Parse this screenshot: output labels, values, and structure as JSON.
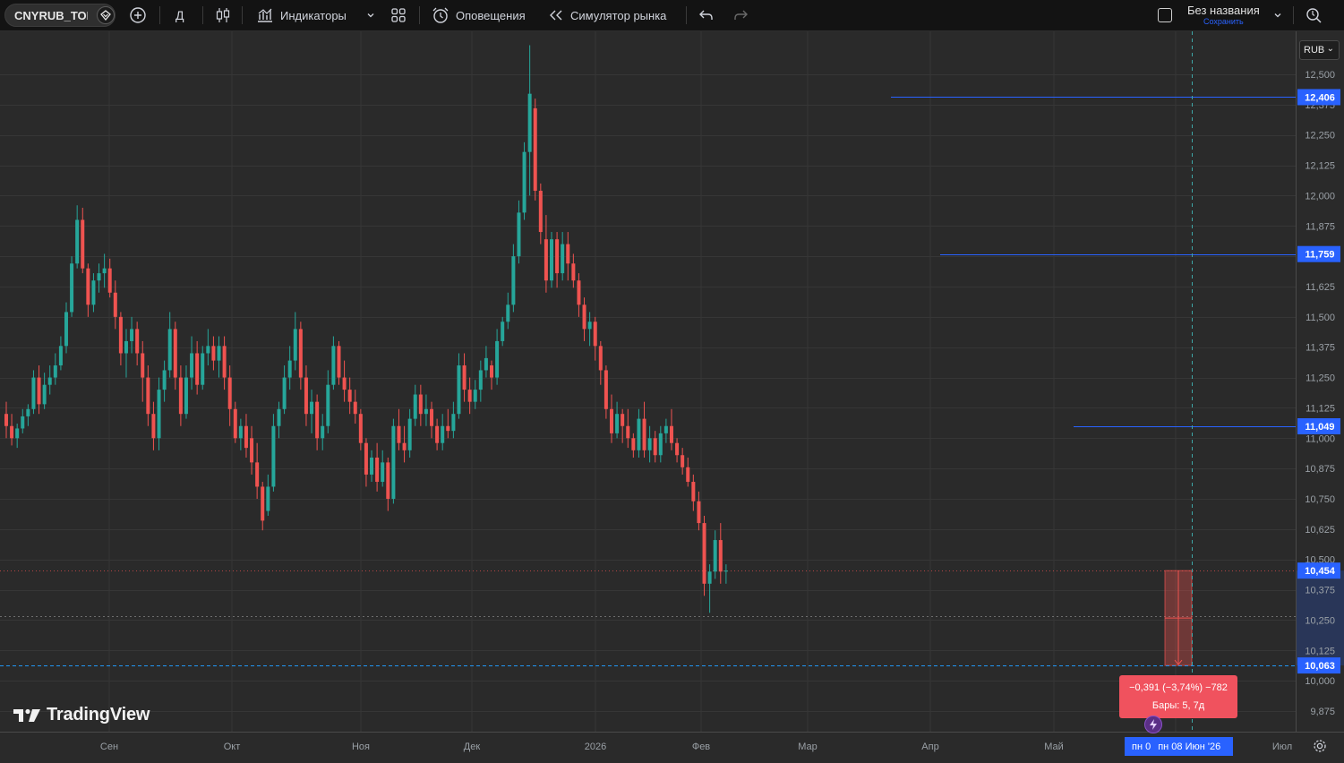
{
  "toolbar": {
    "symbol": "CNYRUB_TOM",
    "add_icon": "plus-circle-icon",
    "interval": "Д",
    "chart_type_icon": "candles-icon",
    "indicators_label": "Индикаторы",
    "templates_icon": "templates-grid-icon",
    "alerts_label": "Оповещения",
    "replay_label": "Симулятор рынка",
    "undo_icon": "undo-icon",
    "redo_icon": "redo-icon",
    "layout_name": "Без названия",
    "layout_save": "Сохранить",
    "quick_search_icon": "search-icon"
  },
  "currency": "RUB",
  "watermark": "TradingView",
  "measure": {
    "line1": "−0,391 (−3,74%) −782",
    "line2": "Бары: 5, 7д"
  },
  "cursor_date": {
    "a": "пн 0",
    "b": "пн 08 Июн '26"
  },
  "colors": {
    "up": "#26a69a",
    "down": "#ef5350",
    "price_line": "#2962ff",
    "crosshair": "#2196f3",
    "background": "#2a2a2a"
  },
  "chart_data": {
    "type": "candlestick",
    "symbol": "CNYRUB_TOM",
    "timeframe": "Д",
    "currency": "RUB",
    "ylim": [
      9.8,
      12.65
    ],
    "y_ticks": [
      "12,500",
      "12,375",
      "12,250",
      "12,125",
      "12,000",
      "11,875",
      "11,750",
      "11,625",
      "11,500",
      "11,375",
      "11,250",
      "11,125",
      "11,000",
      "10,875",
      "10,750",
      "10,625",
      "10,500",
      "10,375",
      "10,250",
      "10,125",
      "10,000",
      "9,875"
    ],
    "x_labels": [
      "Сен",
      "Окт",
      "Ноя",
      "Дек",
      "2026",
      "Фев",
      "Мар",
      "Апр",
      "Май",
      "Июл"
    ],
    "price_labels": [
      {
        "value": 12.406,
        "text": "12,406"
      },
      {
        "value": 11.759,
        "text": "11,759"
      },
      {
        "value": 11.049,
        "text": "11,049"
      },
      {
        "value": 10.454,
        "text": "10,454"
      },
      {
        "value": 10.063,
        "text": "10,063"
      }
    ],
    "horizontal_rays": [
      {
        "value": 12.406,
        "start": "2026-03-20"
      },
      {
        "value": 11.759,
        "start": "2026-04-01"
      },
      {
        "value": 11.049,
        "start": "2026-05-04"
      }
    ],
    "last_close": 10.454,
    "measure_target": 10.063,
    "crosshair_price": 10.063,
    "crosshair_date": "2026-06-08",
    "candles_ohlc": [
      [
        11.1,
        11.15,
        11.0,
        11.05
      ],
      [
        11.05,
        11.1,
        10.97,
        11.0
      ],
      [
        11.0,
        11.06,
        10.96,
        11.04
      ],
      [
        11.04,
        11.12,
        11.02,
        11.09
      ],
      [
        11.09,
        11.14,
        11.05,
        11.12
      ],
      [
        11.12,
        11.28,
        11.1,
        11.25
      ],
      [
        11.25,
        11.3,
        11.1,
        11.14
      ],
      [
        11.14,
        11.27,
        11.12,
        11.22
      ],
      [
        11.22,
        11.3,
        11.18,
        11.25
      ],
      [
        11.25,
        11.35,
        11.22,
        11.3
      ],
      [
        11.3,
        11.42,
        11.28,
        11.38
      ],
      [
        11.38,
        11.56,
        11.35,
        11.52
      ],
      [
        11.52,
        11.75,
        11.5,
        11.72
      ],
      [
        11.72,
        11.96,
        11.7,
        11.9
      ],
      [
        11.9,
        11.95,
        11.68,
        11.7
      ],
      [
        11.7,
        11.72,
        11.5,
        11.55
      ],
      [
        11.55,
        11.68,
        11.52,
        11.65
      ],
      [
        11.65,
        11.72,
        11.6,
        11.68
      ],
      [
        11.68,
        11.76,
        11.62,
        11.7
      ],
      [
        11.7,
        11.74,
        11.58,
        11.6
      ],
      [
        11.6,
        11.65,
        11.45,
        11.5
      ],
      [
        11.5,
        11.52,
        11.3,
        11.35
      ],
      [
        11.35,
        11.45,
        11.25,
        11.4
      ],
      [
        11.4,
        11.5,
        11.35,
        11.45
      ],
      [
        11.45,
        11.48,
        11.3,
        11.35
      ],
      [
        11.35,
        11.4,
        11.15,
        11.25
      ],
      [
        11.25,
        11.3,
        11.05,
        11.1
      ],
      [
        11.1,
        11.15,
        10.95,
        11.0
      ],
      [
        11.0,
        11.25,
        10.95,
        11.2
      ],
      [
        11.2,
        11.32,
        11.15,
        11.28
      ],
      [
        11.28,
        11.52,
        11.25,
        11.45
      ],
      [
        11.45,
        11.48,
        11.2,
        11.25
      ],
      [
        11.25,
        11.3,
        11.05,
        11.1
      ],
      [
        11.1,
        11.3,
        11.08,
        11.25
      ],
      [
        11.25,
        11.42,
        11.2,
        11.35
      ],
      [
        11.35,
        11.4,
        11.18,
        11.22
      ],
      [
        11.22,
        11.38,
        11.2,
        11.35
      ],
      [
        11.35,
        11.45,
        11.3,
        11.38
      ],
      [
        11.38,
        11.42,
        11.28,
        11.32
      ],
      [
        11.32,
        11.42,
        11.25,
        11.38
      ],
      [
        11.38,
        11.42,
        11.2,
        11.25
      ],
      [
        11.25,
        11.3,
        11.05,
        11.12
      ],
      [
        11.12,
        11.15,
        10.98,
        11.0
      ],
      [
        11.0,
        11.08,
        10.95,
        11.05
      ],
      [
        11.05,
        11.1,
        10.92,
        10.96
      ],
      [
        11.0,
        11.05,
        10.85,
        10.9
      ],
      [
        10.9,
        10.98,
        10.75,
        10.8
      ],
      [
        10.8,
        10.82,
        10.62,
        10.66
      ],
      [
        10.7,
        10.85,
        10.68,
        10.8
      ],
      [
        10.8,
        11.1,
        10.78,
        11.05
      ],
      [
        11.05,
        11.15,
        11.0,
        11.12
      ],
      [
        11.12,
        11.3,
        11.1,
        11.25
      ],
      [
        11.25,
        11.38,
        11.2,
        11.32
      ],
      [
        11.32,
        11.52,
        11.28,
        11.45
      ],
      [
        11.45,
        11.48,
        11.2,
        11.25
      ],
      [
        11.25,
        11.3,
        11.05,
        11.1
      ],
      [
        11.1,
        11.2,
        11.02,
        11.15
      ],
      [
        11.15,
        11.18,
        10.95,
        11.0
      ],
      [
        11.0,
        11.1,
        10.95,
        11.05
      ],
      [
        11.05,
        11.28,
        11.02,
        11.22
      ],
      [
        11.22,
        11.42,
        11.2,
        11.38
      ],
      [
        11.38,
        11.4,
        11.22,
        11.25
      ],
      [
        11.25,
        11.32,
        11.15,
        11.2
      ],
      [
        11.2,
        11.25,
        11.1,
        11.15
      ],
      [
        11.15,
        11.2,
        11.06,
        11.1
      ],
      [
        11.1,
        11.12,
        10.95,
        10.98
      ],
      [
        10.98,
        11.0,
        10.8,
        10.85
      ],
      [
        10.85,
        10.95,
        10.82,
        10.92
      ],
      [
        10.92,
        10.98,
        10.78,
        10.82
      ],
      [
        10.82,
        10.95,
        10.8,
        10.9
      ],
      [
        10.9,
        10.92,
        10.7,
        10.75
      ],
      [
        10.75,
        11.08,
        10.73,
        11.05
      ],
      [
        11.05,
        11.12,
        10.95,
        10.98
      ],
      [
        10.98,
        11.05,
        10.9,
        10.95
      ],
      [
        10.95,
        11.12,
        10.92,
        11.08
      ],
      [
        11.08,
        11.22,
        11.05,
        11.18
      ],
      [
        11.18,
        11.22,
        11.05,
        11.1
      ],
      [
        11.1,
        11.18,
        11.05,
        11.12
      ],
      [
        11.12,
        11.15,
        11.0,
        11.05
      ],
      [
        11.05,
        11.08,
        10.95,
        10.98
      ],
      [
        10.98,
        11.1,
        10.95,
        11.05
      ],
      [
        11.05,
        11.12,
        11.0,
        11.03
      ],
      [
        11.03,
        11.15,
        11.0,
        11.1
      ],
      [
        11.1,
        11.35,
        11.08,
        11.3
      ],
      [
        11.3,
        11.35,
        11.15,
        11.2
      ],
      [
        11.2,
        11.25,
        11.1,
        11.15
      ],
      [
        11.15,
        11.24,
        11.12,
        11.2
      ],
      [
        11.2,
        11.32,
        11.15,
        11.28
      ],
      [
        11.28,
        11.38,
        11.25,
        11.33
      ],
      [
        11.3,
        11.32,
        11.2,
        11.25
      ],
      [
        11.25,
        11.45,
        11.22,
        11.4
      ],
      [
        11.4,
        11.5,
        11.38,
        11.48
      ],
      [
        11.48,
        11.6,
        11.45,
        11.55
      ],
      [
        11.55,
        11.8,
        11.52,
        11.75
      ],
      [
        11.75,
        11.98,
        11.72,
        11.93
      ],
      [
        11.93,
        12.22,
        11.9,
        12.18
      ],
      [
        12.18,
        12.62,
        12.0,
        12.42
      ],
      [
        12.36,
        12.4,
        11.98,
        12.02
      ],
      [
        12.02,
        12.05,
        11.8,
        11.85
      ],
      [
        11.82,
        11.92,
        11.6,
        11.65
      ],
      [
        11.65,
        11.85,
        11.62,
        11.82
      ],
      [
        11.82,
        11.85,
        11.62,
        11.68
      ],
      [
        11.68,
        11.85,
        11.65,
        11.8
      ],
      [
        11.8,
        11.85,
        11.65,
        11.72
      ],
      [
        11.72,
        11.76,
        11.62,
        11.65
      ],
      [
        11.65,
        11.68,
        11.5,
        11.55
      ],
      [
        11.55,
        11.58,
        11.4,
        11.45
      ],
      [
        11.45,
        11.52,
        11.38,
        11.48
      ],
      [
        11.48,
        11.5,
        11.32,
        11.38
      ],
      [
        11.38,
        11.4,
        11.22,
        11.28
      ],
      [
        11.28,
        11.3,
        11.08,
        11.12
      ],
      [
        11.12,
        11.18,
        10.98,
        11.02
      ],
      [
        11.02,
        11.15,
        11.0,
        11.1
      ],
      [
        11.1,
        11.12,
        10.98,
        11.05
      ],
      [
        11.05,
        11.12,
        10.96,
        11.0
      ],
      [
        11.0,
        11.02,
        10.92,
        10.95
      ],
      [
        10.95,
        11.12,
        10.92,
        11.08
      ],
      [
        11.08,
        11.15,
        10.92,
        10.95
      ],
      [
        10.95,
        11.05,
        10.9,
        11.0
      ],
      [
        11.0,
        11.03,
        10.9,
        10.93
      ],
      [
        10.93,
        11.05,
        10.9,
        11.02
      ],
      [
        11.02,
        11.08,
        10.98,
        11.05
      ],
      [
        11.05,
        11.12,
        10.95,
        10.98
      ],
      [
        10.98,
        11.0,
        10.9,
        10.93
      ],
      [
        10.93,
        10.96,
        10.85,
        10.88
      ],
      [
        10.88,
        10.92,
        10.8,
        10.82
      ],
      [
        10.82,
        10.85,
        10.7,
        10.74
      ],
      [
        10.74,
        10.78,
        10.62,
        10.65
      ],
      [
        10.65,
        10.68,
        10.35,
        10.4
      ],
      [
        10.4,
        10.48,
        10.28,
        10.45
      ],
      [
        10.45,
        10.62,
        10.42,
        10.58
      ],
      [
        10.58,
        10.65,
        10.4,
        10.45
      ],
      [
        10.45,
        10.48,
        10.4,
        10.454
      ]
    ]
  }
}
